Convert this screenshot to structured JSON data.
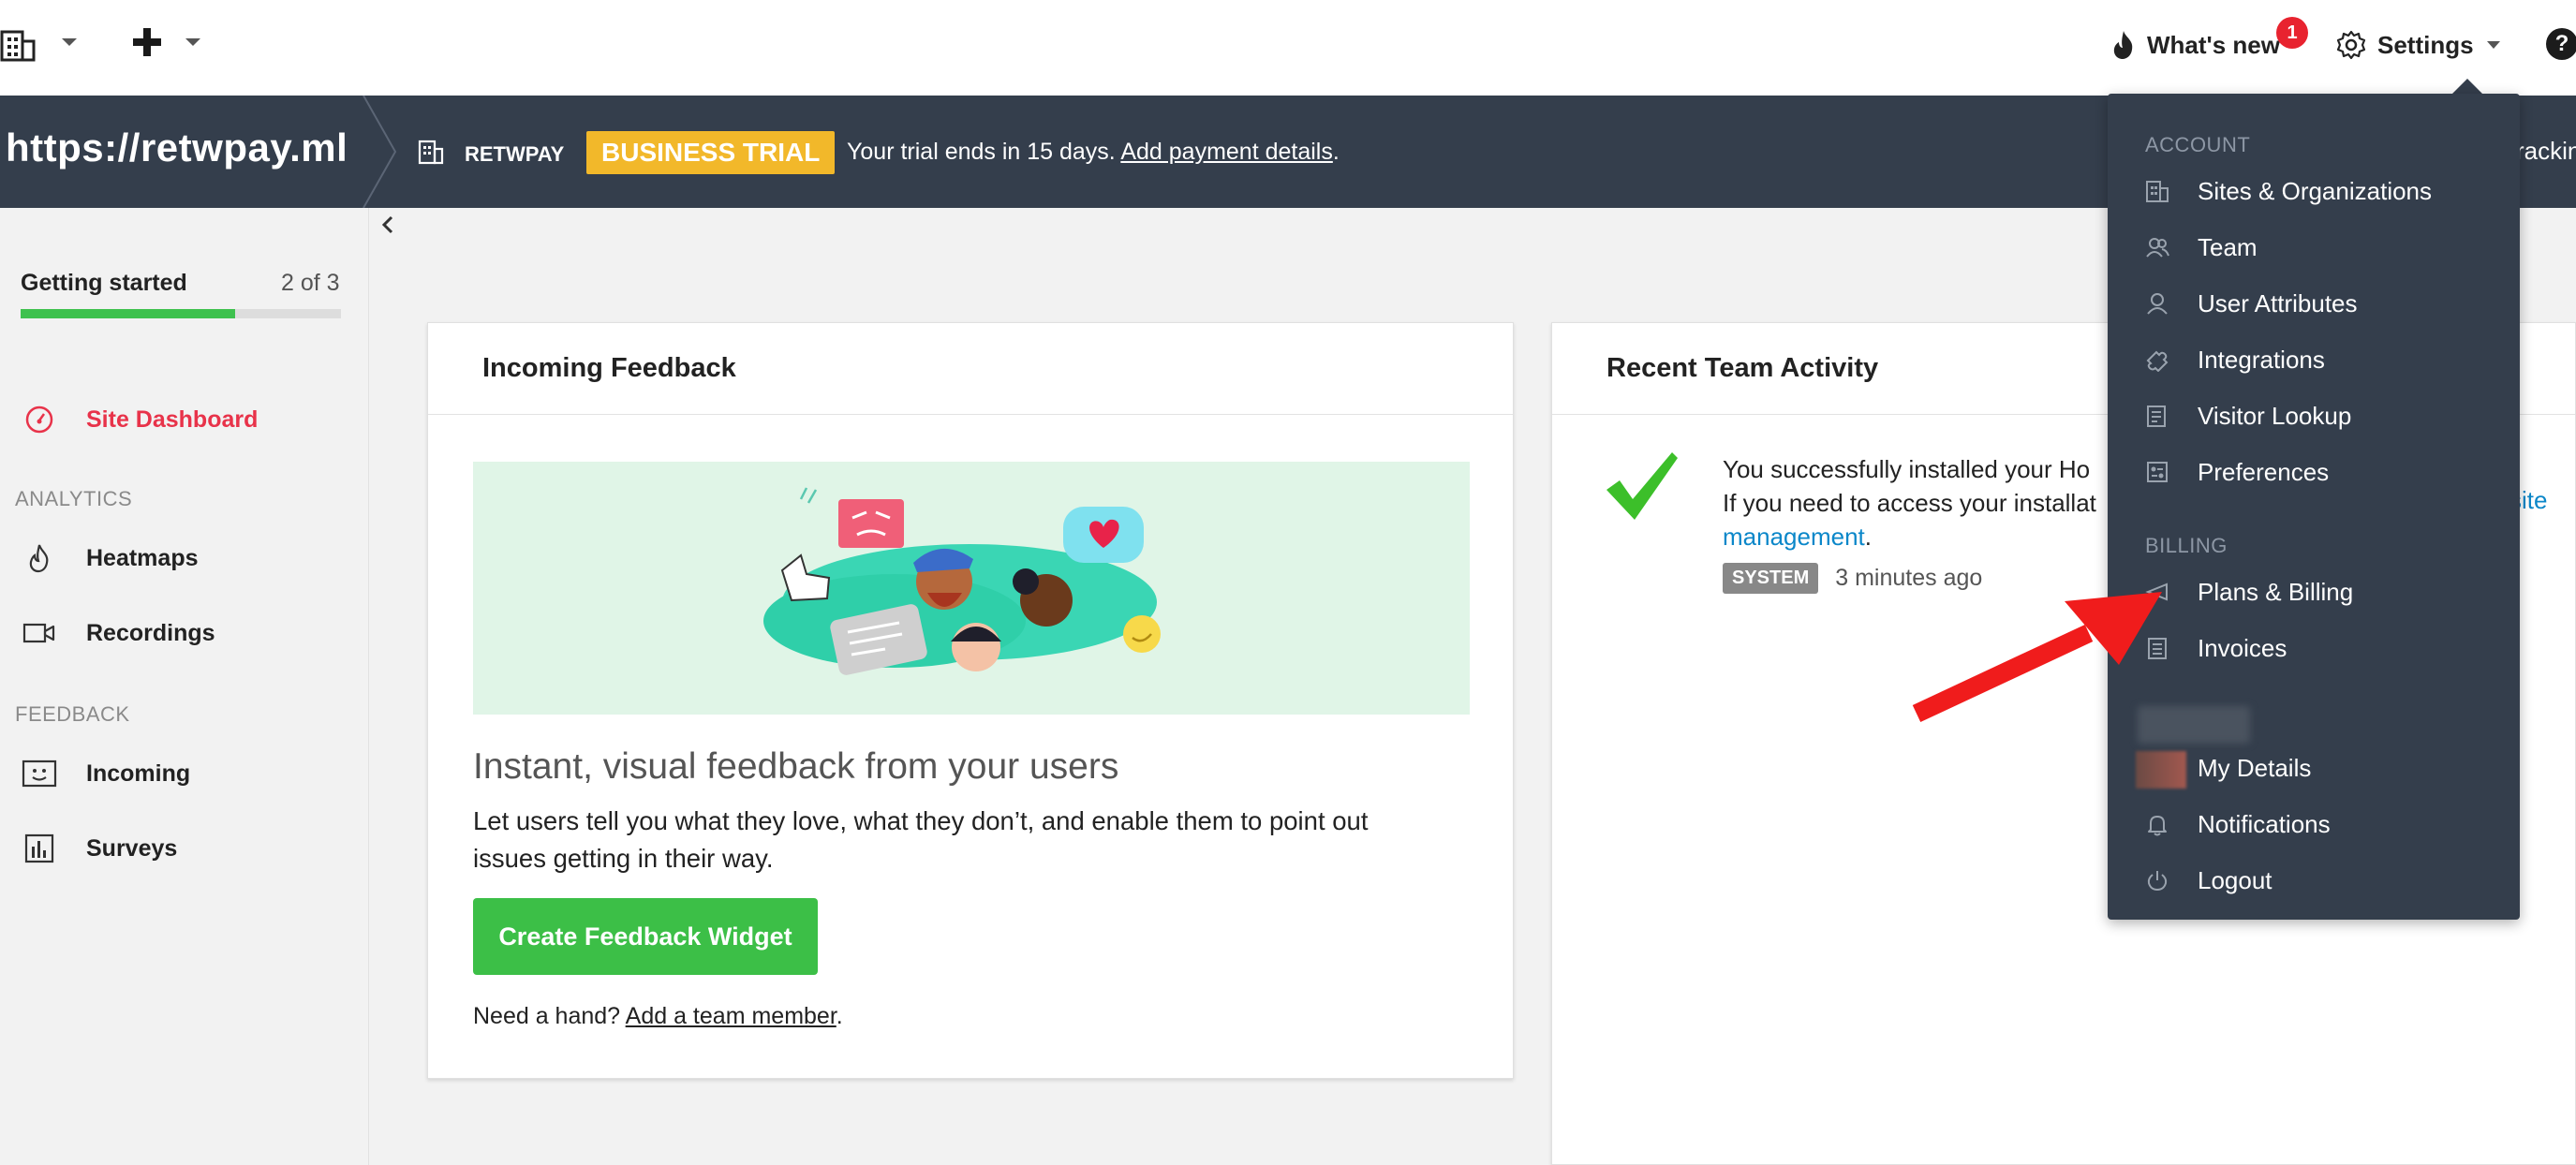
{
  "topnav": {
    "building_icon": "building-icon",
    "plus_icon": "plus-icon",
    "whats_new_label": "What's new",
    "whats_new_badge": "1",
    "settings_label": "Settings",
    "help_label": "?"
  },
  "trialbar": {
    "site_url": "https://retwpay.ml",
    "org_name": "RETWPAY",
    "trial_badge": "BUSINESS TRIAL",
    "trial_text": "Your trial ends in 15 days. ",
    "add_payment_link": "Add payment details",
    "trial_text_end": ".",
    "tracking_partial": "rackin",
    "colors": {
      "bar": "#343e4c",
      "badge": "#f2b82a"
    }
  },
  "sidebar": {
    "getting_started": {
      "title": "Getting started",
      "count": "2 of 3",
      "progress": 0.67
    },
    "site_dashboard": "Site Dashboard",
    "analytics_label": "ANALYTICS",
    "heatmaps": "Heatmaps",
    "recordings": "Recordings",
    "feedback_label": "FEEDBACK",
    "incoming": "Incoming",
    "surveys": "Surveys",
    "active_color": "#e8334a"
  },
  "feedback_card": {
    "title": "Incoming Feedback",
    "hero_title": "Instant, visual feedback from your users",
    "hero_text": "Let users tell you what they love, what they don’t, and enable them to point out issues getting in their way.",
    "cta_label": "Create Feedback Widget",
    "need_hand": "Need a hand? ",
    "add_member_link": "Add a team member",
    "need_hand_end": "."
  },
  "activity_card": {
    "title": "Recent Team Activity",
    "line1": "You successfully installed your Ho",
    "line2": "If you need to access your installat",
    "link_part1": "site",
    "link_part2": "management",
    "link_end": ".",
    "tag": "SYSTEM",
    "time": "3 minutes ago"
  },
  "settings_menu": {
    "account_label": "ACCOUNT",
    "account_items": [
      {
        "label": "Sites & Organizations",
        "icon": "building-icon"
      },
      {
        "label": "Team",
        "icon": "team-icon"
      },
      {
        "label": "User Attributes",
        "icon": "user-icon"
      },
      {
        "label": "Integrations",
        "icon": "puzzle-icon"
      },
      {
        "label": "Visitor Lookup",
        "icon": "lookup-icon"
      },
      {
        "label": "Preferences",
        "icon": "preferences-icon"
      }
    ],
    "billing_label": "BILLING",
    "billing_items": [
      {
        "label": "Plans & Billing",
        "icon": "plans-icon"
      },
      {
        "label": "Invoices",
        "icon": "invoice-icon"
      }
    ],
    "user_items": [
      {
        "label": "My Details",
        "icon": "avatar"
      },
      {
        "label": "Notifications",
        "icon": "bell-icon"
      },
      {
        "label": "Logout",
        "icon": "power-icon"
      }
    ]
  },
  "annotation": {
    "arrow_color": "#f01c1c"
  }
}
